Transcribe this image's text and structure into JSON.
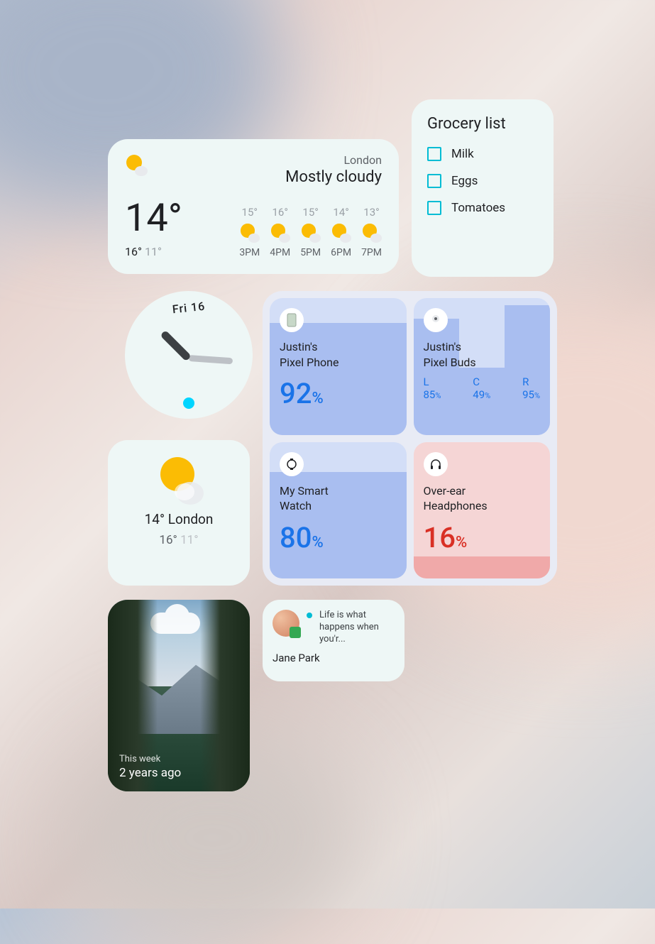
{
  "weather_wide": {
    "location": "London",
    "condition": "Mostly cloudy",
    "temp": "14°",
    "hi": "16°",
    "lo": "11°",
    "hours": [
      {
        "temp": "15°",
        "label": "3PM"
      },
      {
        "temp": "16°",
        "label": "4PM"
      },
      {
        "temp": "15°",
        "label": "5PM"
      },
      {
        "temp": "14°",
        "label": "6PM"
      },
      {
        "temp": "13°",
        "label": "7PM"
      }
    ]
  },
  "grocery": {
    "title": "Grocery list",
    "items": [
      "Milk",
      "Eggs",
      "Tomatoes"
    ]
  },
  "clock": {
    "day": "Fri 16"
  },
  "battery": {
    "devices": [
      {
        "name": "Justin's\nPixel Phone",
        "pct": "92",
        "icon": "phone",
        "fill": 82
      },
      {
        "name": "Justin's\nPixel Buds",
        "icon": "buds",
        "lcr": {
          "L": "85",
          "C": "49",
          "R": "95"
        }
      },
      {
        "name": "My Smart\nWatch",
        "pct": "80",
        "icon": "watch",
        "fill": 78
      },
      {
        "name": "Over-ear\nHeadphones",
        "pct": "16",
        "icon": "headphones",
        "fill": 16,
        "low": true
      }
    ]
  },
  "weather_small": {
    "temp": "14°",
    "location": "London",
    "hi": "16°",
    "lo": "11°"
  },
  "photo": {
    "line1": "This week",
    "line2": "2 years ago"
  },
  "contact": {
    "message": "Life is what happens when you'r...",
    "name": "Jane Park"
  }
}
